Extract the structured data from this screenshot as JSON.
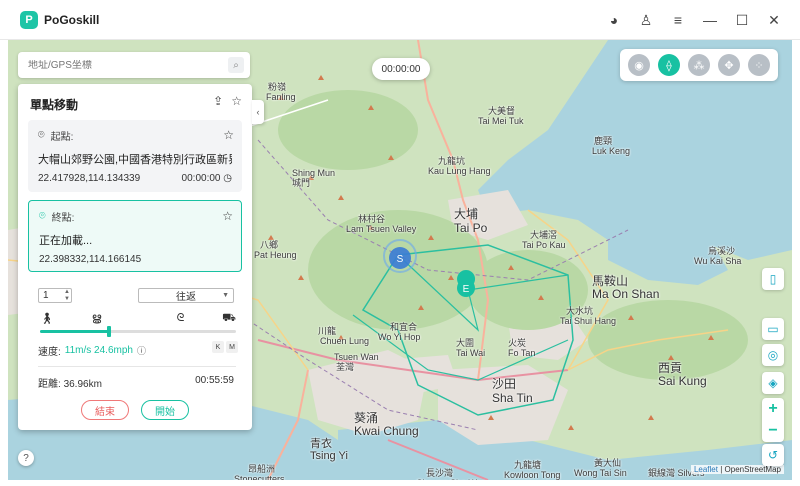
{
  "app": {
    "title": "PoGoskill",
    "logo_letter": "P"
  },
  "window_controls": [
    {
      "name": "discord-icon",
      "glyph": "◕"
    },
    {
      "name": "account-icon",
      "glyph": "♙"
    },
    {
      "name": "menu-icon",
      "glyph": "≡"
    },
    {
      "name": "minimize-icon",
      "glyph": "—"
    },
    {
      "name": "maximize-icon",
      "glyph": "☐"
    },
    {
      "name": "close-icon",
      "glyph": "✕"
    }
  ],
  "search": {
    "placeholder": "地址/GPS坐標"
  },
  "timer": "00:00:00",
  "panel": {
    "title": "單點移動",
    "start": {
      "label": "起點:",
      "address": "大帽山郊野公園,中國香港特別行政區新界...",
      "coords": "22.417928,114.134339",
      "time": "00:00:00"
    },
    "end": {
      "label": "終點:",
      "address": "正在加載...",
      "coords": "22.398332,114.166145"
    },
    "count": "1",
    "route_mode": "往返",
    "speed_label": "速度:",
    "speed_value": "11m/s 24.6mph",
    "unit_k": "K",
    "unit_m": "M",
    "distance_label": "距離:",
    "distance_value": "36.96km",
    "duration": "00:55:59",
    "speed_fraction": 0.35,
    "end_button": "結束",
    "start_button": "開始"
  },
  "map": {
    "attribution_leaflet": "Leaflet",
    "attribution_osm": "| OpenStreetMap",
    "labels": [
      {
        "text": "Shing Mun",
        "cls": "",
        "pos": [
          0,
          0
        ]
      },
      {
        "text": "城門",
        "cls": "",
        "pos": [
          0,
          0
        ]
      },
      {
        "text": "Tsuen Wan",
        "cls": "",
        "pos": [
          0,
          0
        ]
      },
      {
        "text": "荃灣",
        "cls": "",
        "pos": [
          0,
          0
        ]
      },
      {
        "text": "大埔",
        "cls": "big",
        "pos": [
          0,
          0
        ]
      },
      {
        "text": "Tai Po",
        "cls": "big",
        "pos": [
          0,
          0
        ]
      },
      {
        "text": "沙田",
        "cls": "big",
        "pos": [
          0,
          0
        ]
      },
      {
        "text": "Sha Tin",
        "cls": "big",
        "pos": [
          0,
          0
        ]
      },
      {
        "text": "馬鞍山",
        "cls": "big",
        "pos": [
          0,
          0
        ]
      },
      {
        "text": "Ma On Shan",
        "cls": "big",
        "pos": [
          0,
          0
        ]
      },
      {
        "text": "西貢",
        "cls": "big",
        "pos": [
          0,
          0
        ]
      },
      {
        "text": "Sai Kung",
        "cls": "big",
        "pos": [
          0,
          0
        ]
      },
      {
        "text": "葵涌",
        "cls": "big",
        "pos": [
          0,
          0
        ]
      },
      {
        "text": "Kwai Chung",
        "cls": "big",
        "pos": [
          0,
          0
        ]
      },
      {
        "text": "青衣",
        "cls": "mid",
        "pos": [
          0,
          0
        ]
      },
      {
        "text": "Tsing Yi",
        "cls": "mid",
        "pos": [
          0,
          0
        ]
      },
      {
        "text": "九龍坑",
        "cls": "",
        "pos": [
          0,
          0
        ]
      },
      {
        "text": "Kau Lung Hang",
        "cls": "",
        "pos": [
          0,
          0
        ]
      },
      {
        "text": "林村谷",
        "cls": "",
        "pos": [
          0,
          0
        ]
      },
      {
        "text": "Lam Tsuen Valley",
        "cls": "",
        "pos": [
          0,
          0
        ]
      },
      {
        "text": "大埔滘",
        "cls": "",
        "pos": [
          0,
          0
        ]
      },
      {
        "text": "Tai Po Kau",
        "cls": "",
        "pos": [
          0,
          0
        ]
      },
      {
        "text": "火炭",
        "cls": "",
        "pos": [
          0,
          0
        ]
      },
      {
        "text": "Fo Tan",
        "cls": "",
        "pos": [
          0,
          0
        ]
      },
      {
        "text": "大圍",
        "cls": "",
        "pos": [
          0,
          0
        ]
      },
      {
        "text": "Tai Wai",
        "cls": "",
        "pos": [
          0,
          0
        ]
      },
      {
        "text": "九龍塘",
        "cls": "",
        "pos": [
          0,
          0
        ]
      },
      {
        "text": "Kowloon Tong",
        "cls": "",
        "pos": [
          0,
          0
        ]
      },
      {
        "text": "長沙灣",
        "cls": "",
        "pos": [
          0,
          0
        ]
      },
      {
        "text": "Cheung Sha Wan",
        "cls": "",
        "pos": [
          0,
          0
        ]
      },
      {
        "text": "昂船洲",
        "cls": "",
        "pos": [
          0,
          0
        ]
      },
      {
        "text": "Stonecutters",
        "cls": "",
        "pos": [
          0,
          0
        ]
      },
      {
        "text": "黃大仙",
        "cls": "",
        "pos": [
          0,
          0
        ]
      },
      {
        "text": "Wong Tai Sin",
        "cls": "",
        "pos": [
          0,
          0
        ]
      },
      {
        "text": "粉嶺",
        "cls": "",
        "pos": [
          0,
          0
        ]
      },
      {
        "text": "Fanling",
        "cls": "",
        "pos": [
          0,
          0
        ]
      },
      {
        "text": "鹿頸",
        "cls": "",
        "pos": [
          0,
          0
        ]
      },
      {
        "text": "Luk Keng",
        "cls": "",
        "pos": [
          0,
          0
        ]
      },
      {
        "text": "大美督",
        "cls": "",
        "pos": [
          0,
          0
        ]
      },
      {
        "text": "Tai Mei Tuk",
        "cls": "",
        "pos": [
          0,
          0
        ]
      },
      {
        "text": "烏溪沙",
        "cls": "",
        "pos": [
          0,
          0
        ]
      },
      {
        "text": "Wu Kai Sha",
        "cls": "",
        "pos": [
          0,
          0
        ]
      },
      {
        "text": "大水坑",
        "cls": "",
        "pos": [
          0,
          0
        ]
      },
      {
        "text": "Tai Shui Hang",
        "cls": "",
        "pos": [
          0,
          0
        ]
      },
      {
        "text": "和宜合",
        "cls": "",
        "pos": [
          0,
          0
        ]
      },
      {
        "text": "Wo Yi Hop",
        "cls": "",
        "pos": [
          0,
          0
        ]
      },
      {
        "text": "川龍",
        "cls": "",
        "pos": [
          0,
          0
        ]
      },
      {
        "text": "Chuen Lung",
        "cls": "",
        "pos": [
          0,
          0
        ]
      },
      {
        "text": "大欖",
        "cls": "",
        "pos": [
          0,
          0
        ]
      },
      {
        "text": "Tai Lam",
        "cls": "",
        "pos": [
          0,
          0
        ]
      },
      {
        "text": "八鄉",
        "cls": "",
        "pos": [
          0,
          0
        ]
      },
      {
        "text": "Pat Heung",
        "cls": "",
        "pos": [
          0,
          0
        ]
      },
      {
        "text": "銀線灣 Silvers",
        "cls": "",
        "pos": [
          0,
          0
        ]
      }
    ]
  },
  "colors": {
    "accent": "#18c1a2",
    "danger": "#e85c5c",
    "water": "#aad3df",
    "land": "#cfe3bf",
    "urban": "#e6e1dc"
  }
}
